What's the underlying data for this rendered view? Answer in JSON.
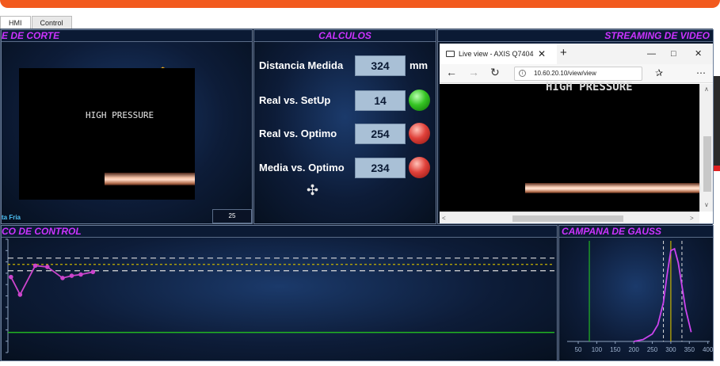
{
  "tabs": [
    {
      "label": "HMI"
    },
    {
      "label": "Control"
    }
  ],
  "panels": {
    "corte": {
      "title": "E DE CORTE",
      "camera_text": "HIGH PRESSURE",
      "bottom_label": "ta Fria",
      "bottom_value": "25",
      "toolbar_icons": [
        "lasso-icon",
        "pan-icon",
        "zoom-in-icon",
        "zoom-out-icon",
        "home-icon"
      ]
    },
    "calculos": {
      "title": "CALCULOS",
      "rows": [
        {
          "label": "Distancia Medida",
          "value": "324",
          "unit": "mm"
        },
        {
          "label": "Real vs. SetUp",
          "value": "14",
          "status": "green"
        },
        {
          "label": "Real vs. Optimo",
          "value": "254",
          "status": "red"
        },
        {
          "label": "Media vs. Optimo",
          "value": "234",
          "status": "red"
        }
      ]
    },
    "streaming": {
      "title": "STREAMING DE VIDEO",
      "browser": {
        "tab_title": "Live view - AXIS Q7404",
        "url": "10.60.20.10/view/view",
        "viewport_text": "HIGH PRESSURE"
      }
    },
    "control": {
      "title": "CO DE CONTROL"
    },
    "gauss": {
      "title": "CAMPANA DE GAUSS"
    }
  },
  "colors": {
    "accent_title": "#cc33ff",
    "background": "#0a1326",
    "control_series": "#cc44cc",
    "limit_dashed": "#dddddd",
    "mean_line": "#c8b400",
    "target_line": "#22b522",
    "gauss_curve": "#cc44ee"
  },
  "chart_data": [
    {
      "type": "line",
      "title": "CO DE CONTROL",
      "series": [
        {
          "values": [
            300,
            230,
            345,
            340,
            296,
            305,
            310,
            320
          ]
        }
      ],
      "xlim": [
        0,
        90
      ],
      "ylim": [
        0,
        450
      ],
      "grid": false
    },
    {
      "type": "line",
      "title": "CAMPANA DE GAUSS",
      "x_ticks": [
        50,
        100,
        150,
        200,
        250,
        300,
        350,
        400
      ],
      "xlim": [
        20,
        405
      ],
      "series": [
        {
          "x": [
            200,
            225,
            250,
            265,
            280,
            290,
            300,
            310,
            320,
            330,
            340,
            355
          ],
          "y": [
            0.0,
            0.02,
            0.08,
            0.18,
            0.42,
            0.72,
            0.98,
            1.0,
            0.85,
            0.6,
            0.35,
            0.1
          ]
        }
      ],
      "vertical_lines": [
        80,
        300,
        280,
        330
      ],
      "grid": false
    }
  ]
}
